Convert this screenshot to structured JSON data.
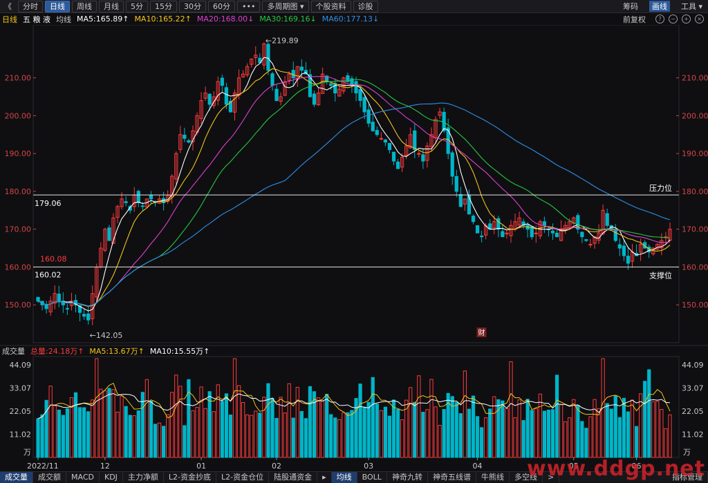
{
  "toolbar": {
    "back_glyph": "《",
    "buttons": [
      "分时",
      "日线",
      "周线",
      "月线",
      "5分",
      "15分",
      "30分",
      "60分",
      "•••",
      "多周期图 ▾",
      "个股资料",
      "诊股"
    ],
    "active_index": 1,
    "right": [
      "筹码",
      "画线",
      "工具 ▾"
    ]
  },
  "main_legend": {
    "period": "日线",
    "stock_name": "五 粮 液",
    "indicator": "均线",
    "ma5": "MA5:165.89↑",
    "ma10": "MA10:165.22↑",
    "ma20": "MA20:168.00↓",
    "ma30": "MA30:169.16↓",
    "ma60": "MA60:177.13↓",
    "adjust": "前复权"
  },
  "volume_legend": {
    "title": "成交量",
    "total": "总量:24.18万↑",
    "ma5": "MA5:13.67万↑",
    "ma10": "MA10:15.55万↑"
  },
  "colors": {
    "up": "#ff3b3b",
    "down": "#00b5c8",
    "ma5": "#ffffff",
    "ma10": "#f5c518",
    "ma20": "#e040d0",
    "ma30": "#27c93f",
    "ma60": "#2f8fe6",
    "axis": "#d24545"
  },
  "annotations": {
    "resistance_label": "压力位",
    "resistance_value": "179.06",
    "support_label": "支撑位",
    "support_value": "160.02",
    "support_value_red": "160.08",
    "high_label": "←219.89",
    "low_label": "←142.05",
    "cai_label": "财"
  },
  "chart_data": {
    "type": "candlestick",
    "price_ticks": [
      "210.00",
      "200.00",
      "190.00",
      "180.00",
      "170.00",
      "160.00",
      "150.00"
    ],
    "price_tick_values": [
      210,
      200,
      190,
      180,
      170,
      160,
      150
    ],
    "ylim": [
      140,
      224
    ],
    "volume_ticks": [
      "44.09",
      "33.07",
      "22.05",
      "11.02"
    ],
    "volume_tick_values": [
      44.09,
      33.07,
      22.05,
      11.02
    ],
    "volume_unit": "万",
    "vlim": [
      0,
      48
    ],
    "x_labels": [
      "2022/11",
      "12",
      "01",
      "02",
      "03",
      "04",
      "05",
      "06"
    ],
    "x_label_index": [
      0,
      16,
      39,
      57,
      79,
      105,
      128,
      143
    ],
    "resistance": 179.06,
    "support": 160.02,
    "high": 219.89,
    "high_index": 54,
    "low": 142.05,
    "low_index": 12,
    "candles_close": [
      151,
      150,
      149,
      151,
      153,
      151,
      150,
      149,
      151,
      150,
      148,
      147,
      146,
      153,
      160,
      165,
      170,
      167,
      173,
      176,
      178,
      177,
      175,
      179,
      177,
      176,
      178,
      178,
      177,
      178,
      177,
      179,
      184,
      190,
      195,
      194,
      193,
      196,
      200,
      204,
      206,
      203,
      205,
      209,
      208,
      203,
      201,
      206,
      210,
      211,
      213,
      215,
      216,
      214,
      219,
      212,
      208,
      204,
      205,
      209,
      211,
      210,
      213,
      212,
      211,
      205,
      203,
      206,
      211,
      209,
      208,
      206,
      207,
      210,
      209,
      208,
      206,
      204,
      201,
      198,
      196,
      195,
      194,
      193,
      191,
      188,
      186,
      189,
      192,
      195,
      191,
      190,
      188,
      192,
      195,
      199,
      201,
      196,
      190,
      184,
      180,
      176,
      178,
      174,
      172,
      169,
      168,
      171,
      170,
      172,
      170,
      168,
      169,
      171,
      172,
      173,
      171,
      170,
      168,
      169,
      172,
      171,
      170,
      169,
      168,
      170,
      171,
      172,
      173,
      170,
      168,
      167,
      166,
      168,
      169,
      175,
      171,
      170,
      167,
      165,
      163,
      161,
      164,
      163,
      166,
      165,
      164,
      165,
      166,
      167,
      168,
      170
    ]
  }
}
